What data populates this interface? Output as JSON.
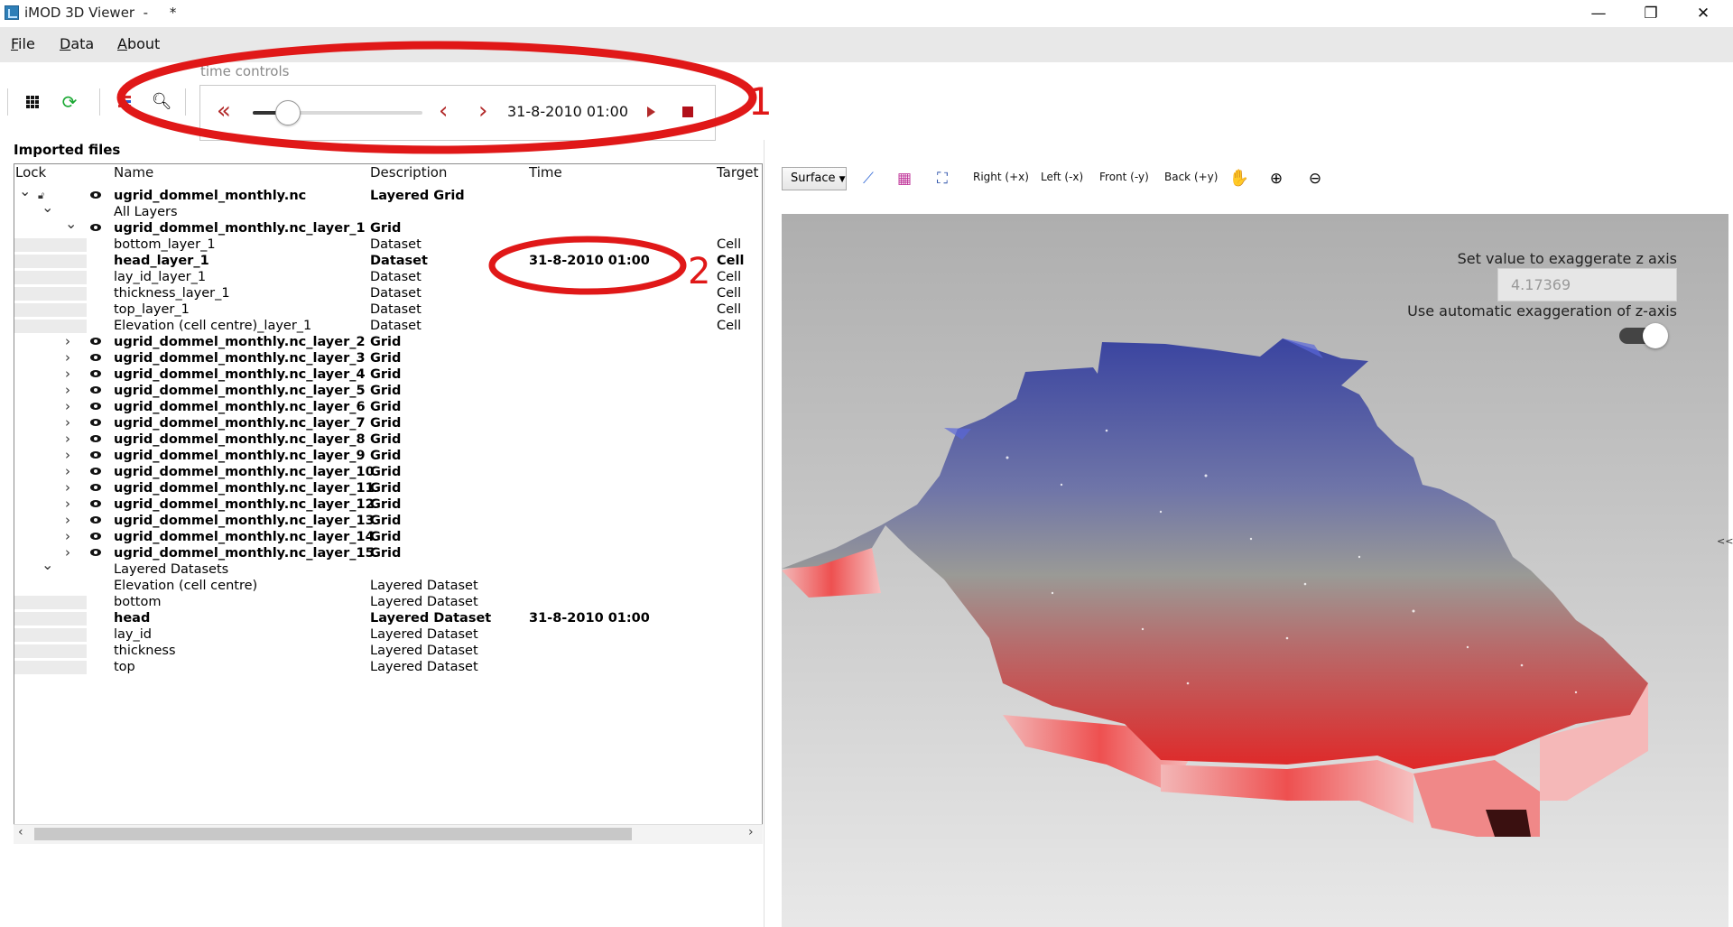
{
  "window": {
    "title": "iMOD 3D Viewer  -     *",
    "minimize_glyph": "—",
    "maximize_glyph": "❐",
    "close_glyph": "✕"
  },
  "menu": {
    "items": [
      {
        "rest": "ile",
        "accel": "F"
      },
      {
        "rest": "ata",
        "accel": "D"
      },
      {
        "rest": "bout",
        "accel": "A"
      }
    ]
  },
  "toolbar": {
    "icons": [
      "grid-icon",
      "refresh-icon",
      "layers-icon",
      "search-icon"
    ]
  },
  "time_controls": {
    "label": "time controls",
    "current_time": "31-8-2010 01:00",
    "slider_position_fraction": 0.21,
    "buttons": [
      "rewind-icon",
      "previous-icon",
      "next-icon",
      "play-icon",
      "stop-icon"
    ]
  },
  "annotations": {
    "one": "1",
    "two": "2",
    "color": "#e01818"
  },
  "imported_files": {
    "label": "Imported files",
    "columns": [
      "Lock",
      "Name",
      "Description",
      "Time",
      "Target"
    ],
    "rows": [
      {
        "name": "ugrid_dommel_monthly.nc",
        "description": "Layered Grid",
        "time": "",
        "target": "",
        "bold": true,
        "eye": true,
        "lock": "unlock",
        "expand": "open",
        "indent": 0
      },
      {
        "name": "All Layers",
        "description": "",
        "time": "",
        "target": "",
        "bold": false,
        "eye": false,
        "lock": "",
        "expand": "open",
        "indent": 1
      },
      {
        "name": "ugrid_dommel_monthly.nc_layer_1",
        "description": "Grid",
        "time": "",
        "target": "",
        "bold": true,
        "eye": true,
        "lock": "",
        "expand": "open",
        "indent": 2
      },
      {
        "name": "bottom_layer_1",
        "description": "Dataset",
        "time": "",
        "target": "Cell",
        "bold": false,
        "eye": false,
        "lock": "box",
        "expand": "",
        "indent": 3
      },
      {
        "name": "head_layer_1",
        "description": "Dataset",
        "time": "31-8-2010 01:00",
        "target": "Cell",
        "bold": true,
        "eye": false,
        "lock": "box",
        "expand": "",
        "indent": 3
      },
      {
        "name": "lay_id_layer_1",
        "description": "Dataset",
        "time": "",
        "target": "Cell",
        "bold": false,
        "eye": false,
        "lock": "box",
        "expand": "",
        "indent": 3
      },
      {
        "name": "thickness_layer_1",
        "description": "Dataset",
        "time": "",
        "target": "Cell",
        "bold": false,
        "eye": false,
        "lock": "box",
        "expand": "",
        "indent": 3
      },
      {
        "name": "top_layer_1",
        "description": "Dataset",
        "time": "",
        "target": "Cell",
        "bold": false,
        "eye": false,
        "lock": "box",
        "expand": "",
        "indent": 3
      },
      {
        "name": "Elevation (cell centre)_layer_1",
        "description": "Dataset",
        "time": "",
        "target": "Cell",
        "bold": false,
        "eye": false,
        "lock": "box",
        "expand": "",
        "indent": 3
      },
      {
        "name": "ugrid_dommel_monthly.nc_layer_2",
        "description": "Grid",
        "time": "",
        "target": "",
        "bold": true,
        "eye": true,
        "lock": "",
        "expand": "closed",
        "indent": 2
      },
      {
        "name": "ugrid_dommel_monthly.nc_layer_3",
        "description": "Grid",
        "time": "",
        "target": "",
        "bold": true,
        "eye": true,
        "lock": "",
        "expand": "closed",
        "indent": 2
      },
      {
        "name": "ugrid_dommel_monthly.nc_layer_4",
        "description": "Grid",
        "time": "",
        "target": "",
        "bold": true,
        "eye": true,
        "lock": "",
        "expand": "closed",
        "indent": 2
      },
      {
        "name": "ugrid_dommel_monthly.nc_layer_5",
        "description": "Grid",
        "time": "",
        "target": "",
        "bold": true,
        "eye": true,
        "lock": "",
        "expand": "closed",
        "indent": 2
      },
      {
        "name": "ugrid_dommel_monthly.nc_layer_6",
        "description": "Grid",
        "time": "",
        "target": "",
        "bold": true,
        "eye": true,
        "lock": "",
        "expand": "closed",
        "indent": 2
      },
      {
        "name": "ugrid_dommel_monthly.nc_layer_7",
        "description": "Grid",
        "time": "",
        "target": "",
        "bold": true,
        "eye": true,
        "lock": "",
        "expand": "closed",
        "indent": 2
      },
      {
        "name": "ugrid_dommel_monthly.nc_layer_8",
        "description": "Grid",
        "time": "",
        "target": "",
        "bold": true,
        "eye": true,
        "lock": "",
        "expand": "closed",
        "indent": 2
      },
      {
        "name": "ugrid_dommel_monthly.nc_layer_9",
        "description": "Grid",
        "time": "",
        "target": "",
        "bold": true,
        "eye": true,
        "lock": "",
        "expand": "closed",
        "indent": 2
      },
      {
        "name": "ugrid_dommel_monthly.nc_layer_10",
        "description": "Grid",
        "time": "",
        "target": "",
        "bold": true,
        "eye": true,
        "lock": "",
        "expand": "closed",
        "indent": 2
      },
      {
        "name": "ugrid_dommel_monthly.nc_layer_11",
        "description": "Grid",
        "time": "",
        "target": "",
        "bold": true,
        "eye": true,
        "lock": "",
        "expand": "closed",
        "indent": 2
      },
      {
        "name": "ugrid_dommel_monthly.nc_layer_12",
        "description": "Grid",
        "time": "",
        "target": "",
        "bold": true,
        "eye": true,
        "lock": "",
        "expand": "closed",
        "indent": 2
      },
      {
        "name": "ugrid_dommel_monthly.nc_layer_13",
        "description": "Grid",
        "time": "",
        "target": "",
        "bold": true,
        "eye": true,
        "lock": "",
        "expand": "closed",
        "indent": 2
      },
      {
        "name": "ugrid_dommel_monthly.nc_layer_14",
        "description": "Grid",
        "time": "",
        "target": "",
        "bold": true,
        "eye": true,
        "lock": "",
        "expand": "closed",
        "indent": 2
      },
      {
        "name": "ugrid_dommel_monthly.nc_layer_15",
        "description": "Grid",
        "time": "",
        "target": "",
        "bold": true,
        "eye": true,
        "lock": "",
        "expand": "closed",
        "indent": 2
      },
      {
        "name": "Layered Datasets",
        "description": "",
        "time": "",
        "target": "",
        "bold": false,
        "eye": false,
        "lock": "",
        "expand": "open",
        "indent": 1
      },
      {
        "name": "Elevation (cell centre)",
        "description": "Layered Dataset",
        "time": "",
        "target": "",
        "bold": false,
        "eye": false,
        "lock": "",
        "expand": "",
        "indent": 3
      },
      {
        "name": "bottom",
        "description": "Layered Dataset",
        "time": "",
        "target": "",
        "bold": false,
        "eye": false,
        "lock": "box",
        "expand": "",
        "indent": 3
      },
      {
        "name": "head",
        "description": "Layered Dataset",
        "time": "31-8-2010 01:00",
        "target": "",
        "bold": true,
        "eye": false,
        "lock": "box",
        "expand": "",
        "indent": 3
      },
      {
        "name": "lay_id",
        "description": "Layered Dataset",
        "time": "",
        "target": "",
        "bold": false,
        "eye": false,
        "lock": "box",
        "expand": "",
        "indent": 3
      },
      {
        "name": "thickness",
        "description": "Layered Dataset",
        "time": "",
        "target": "",
        "bold": false,
        "eye": false,
        "lock": "box",
        "expand": "",
        "indent": 3
      },
      {
        "name": "top",
        "description": "Layered Dataset",
        "time": "",
        "target": "",
        "bold": false,
        "eye": false,
        "lock": "box",
        "expand": "",
        "indent": 3
      }
    ]
  },
  "viewer": {
    "view_dropdown": "Surface",
    "view_buttons": [
      "Right (+x)",
      "Left (-x)",
      "Front (-y)",
      "Back (+y)"
    ],
    "tool_icons": [
      "axes-icon",
      "bounding-box-icon",
      "fit-view-icon",
      "pan-hand-icon",
      "zoom-in-icon",
      "zoom-out-icon"
    ],
    "exaggeration_label": "Set value to exaggerate z axis",
    "exaggeration_value": "4.17369",
    "auto_exaggeration_label": "Use automatic exaggeration of z-axis",
    "auto_exaggeration_on": true,
    "collapse_label": "<<",
    "surface_colors": {
      "high": "#3a4aa8",
      "mid": "#9a9a9a",
      "low": "#e83a3a",
      "edge": "#f09090"
    }
  }
}
